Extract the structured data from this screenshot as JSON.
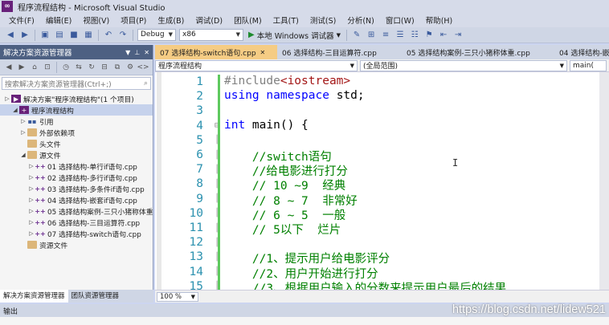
{
  "window": {
    "title": "程序流程结构 - Microsoft Visual Studio"
  },
  "menu": [
    "文件(F)",
    "编辑(E)",
    "视图(V)",
    "项目(P)",
    "生成(B)",
    "调试(D)",
    "团队(M)",
    "工具(T)",
    "测试(S)",
    "分析(N)",
    "窗口(W)",
    "帮助(H)"
  ],
  "toolbar": {
    "config": "Debug",
    "platform": "x86",
    "run_label": "本地 Windows 调试器"
  },
  "solution_explorer": {
    "title": "解决方案资源管理器",
    "search_placeholder": "搜索解决方案资源管理器(Ctrl+;)",
    "items": [
      {
        "label": "解决方案\"程序流程结构\"(1 个项目)",
        "icon": "solution-icon",
        "depth": 0
      },
      {
        "label": "程序流程结构",
        "icon": "project-icon",
        "depth": 1
      },
      {
        "label": "引用",
        "icon": "references-icon",
        "depth": 2
      },
      {
        "label": "外部依赖项",
        "icon": "folder-icon",
        "depth": 2
      },
      {
        "label": "头文件",
        "icon": "folder-icon",
        "depth": 2
      },
      {
        "label": "源文件",
        "icon": "folder-icon",
        "depth": 2
      },
      {
        "label": "01 选择结构-单行if语句.cpp",
        "icon": "cpp-file-icon",
        "depth": 3
      },
      {
        "label": "02 选择结构-多行if语句.cpp",
        "icon": "cpp-file-icon",
        "depth": 3
      },
      {
        "label": "03 选择结构-多条件if语句.cpp",
        "icon": "cpp-file-icon",
        "depth": 3
      },
      {
        "label": "04 选择结构-嵌套if语句.cpp",
        "icon": "cpp-file-icon",
        "depth": 3
      },
      {
        "label": "05 选择结构案例-三只小猪称体重",
        "icon": "cpp-file-icon",
        "depth": 3
      },
      {
        "label": "06 选择结构-三目运算符.cpp",
        "icon": "cpp-file-icon",
        "depth": 3
      },
      {
        "label": "07 选择结构-switch语句.cpp",
        "icon": "cpp-file-icon",
        "depth": 3
      },
      {
        "label": "资源文件",
        "icon": "folder-icon",
        "depth": 2
      }
    ],
    "bottom_tabs": [
      "解决方案资源管理器",
      "团队资源管理器"
    ]
  },
  "editor": {
    "tabs": [
      {
        "label": "07 选择结构-switch语句.cpp",
        "active": true
      },
      {
        "label": "06 选择结构-三目运算符.cpp",
        "active": false
      },
      {
        "label": "05 选择结构案例-三只小猪称体重.cpp",
        "active": false
      },
      {
        "label": "04 选择结构-嵌",
        "active": false
      }
    ],
    "nav_project": "程序流程结构",
    "nav_scope": "(全局范围)",
    "nav_member": "main(",
    "zoom": "100 %",
    "lines": [
      {
        "n": "1",
        "text": "#include<iostream>"
      },
      {
        "n": "2",
        "text": "using namespace std;"
      },
      {
        "n": "3",
        "text": ""
      },
      {
        "n": "4",
        "text": "int main() {"
      },
      {
        "n": "5",
        "text": ""
      },
      {
        "n": "6",
        "text": "    //switch语句"
      },
      {
        "n": "7",
        "text": "    //给电影进行打分"
      },
      {
        "n": "8",
        "text": "    // 10 ~9  经典"
      },
      {
        "n": "9",
        "text": "    // 8 ~ 7  非常好"
      },
      {
        "n": "10",
        "text": "    // 6 ~ 5  一般"
      },
      {
        "n": "11",
        "text": "    // 5以下  烂片"
      },
      {
        "n": "12",
        "text": ""
      },
      {
        "n": "13",
        "text": "    //1、提示用户给电影评分"
      },
      {
        "n": "14",
        "text": "    //2、用户开始进行打分"
      },
      {
        "n": "15",
        "text": "    //3、根据用户输入的分数来提示用户最后的结果"
      }
    ]
  },
  "output": {
    "title": "输出"
  },
  "watermark": "https://blog.csdn.net/lidew521"
}
